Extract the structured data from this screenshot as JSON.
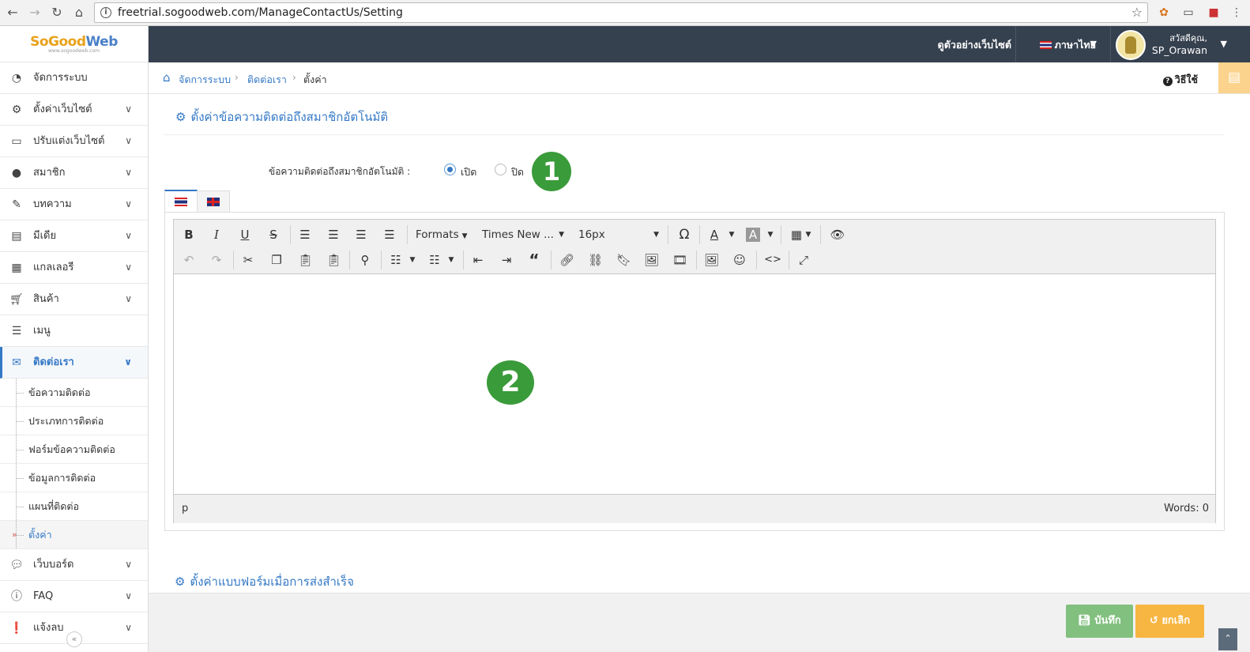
{
  "browser": {
    "url": "freetrial.sogoodweb.com/ManageContactUs/Setting"
  },
  "logo": {
    "text_a": "SoGood",
    "text_b": "Web",
    "tagline": "www.sogoodweb.com"
  },
  "sidebar": {
    "items": [
      {
        "label": "จัดการระบบ",
        "icon": "dashboard-icon"
      },
      {
        "label": "ตั้งค่าเว็บไซต์",
        "icon": "gear-icon"
      },
      {
        "label": "ปรับแต่งเว็บไซต์",
        "icon": "monitor-icon"
      },
      {
        "label": "สมาชิก",
        "icon": "user-icon"
      },
      {
        "label": "บทความ",
        "icon": "edit-icon"
      },
      {
        "label": "มีเดีย",
        "icon": "film-icon"
      },
      {
        "label": "แกลเลอรี",
        "icon": "grid-icon"
      },
      {
        "label": "สินค้า",
        "icon": "cart-icon"
      },
      {
        "label": "เมนู",
        "icon": "menu-icon"
      },
      {
        "label": "ติดต่อเรา",
        "icon": "envelope-icon"
      },
      {
        "label": "เว็บบอร์ด",
        "icon": "chat-icon"
      },
      {
        "label": "FAQ",
        "icon": "info-icon"
      },
      {
        "label": "แจ้งลบ",
        "icon": "alert-icon"
      }
    ],
    "subitems": [
      {
        "label": "ข้อความติดต่อ"
      },
      {
        "label": "ประเภทการติดต่อ"
      },
      {
        "label": "ฟอร์มข้อความติดต่อ"
      },
      {
        "label": "ข้อมูลการติดต่อ"
      },
      {
        "label": "แผนที่ติดต่อ"
      },
      {
        "label": "ตั้งค่า"
      }
    ]
  },
  "topbar": {
    "view_site": "ดูตัวอย่างเว็บไซต์",
    "language": "ภาษาไทย",
    "greeting": "สวัสดีคุณ,",
    "username": "SP_Orawan"
  },
  "breadcrumb": {
    "items": [
      "จัดการระบบ",
      "ติดต่อเรา",
      "ตั้งค่า"
    ],
    "help": "วิธีใช้"
  },
  "section1": {
    "title": "ตั้งค่าข้อความติดต่อถึงสมาชิกอัตโนมัติ",
    "field_label": "ข้อความติดต่อถึงสมาชิกอัตโนมัติ :",
    "option_on": "เปิด",
    "option_off": "ปิด",
    "selected": "เปิด"
  },
  "badges": {
    "one": "1",
    "two": "2"
  },
  "editor": {
    "formats": "Formats",
    "font": "Times New ...",
    "size": "16px",
    "path": "p",
    "words": "Words: 0"
  },
  "section2": {
    "title": "ตั้งค่าแบบฟอร์มเมื่อการส่งสำเร็จ"
  },
  "footer": {
    "save": "บันทึก",
    "cancel": "ยกเลิก"
  },
  "colors": {
    "accent": "#3478c6",
    "topbar": "#36414f",
    "badge": "#3a9b3a",
    "save": "#82c07f",
    "cancel": "#f7b541"
  }
}
